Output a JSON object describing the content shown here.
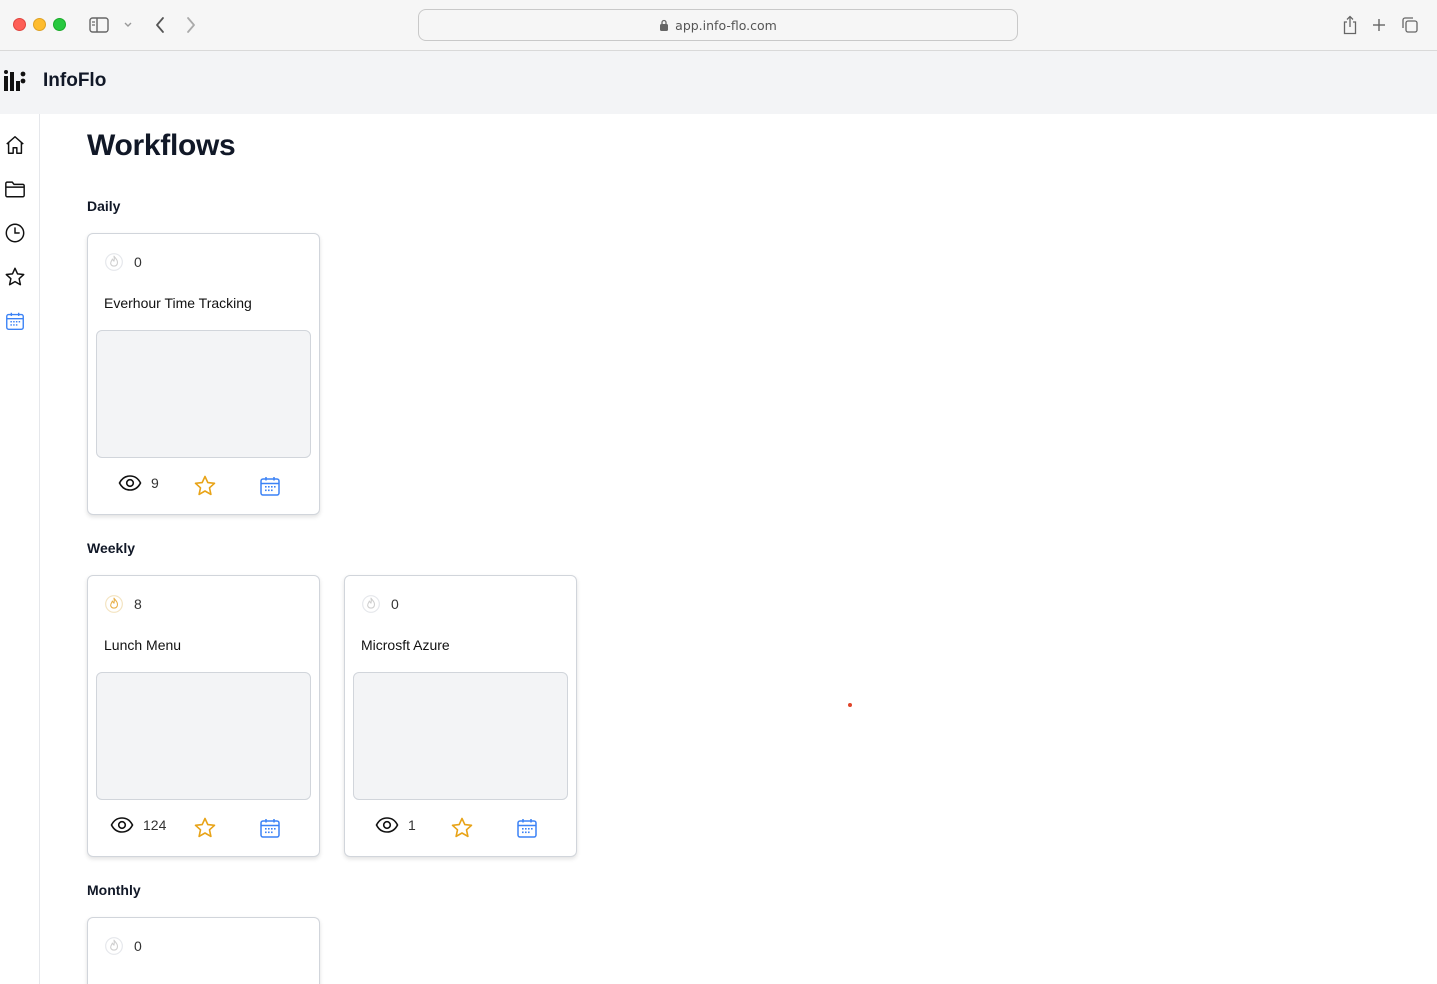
{
  "browser": {
    "url": "app.info-flo.com"
  },
  "app": {
    "name": "InfoFlo"
  },
  "sidebar": {
    "items": [
      {
        "icon": "home-icon"
      },
      {
        "icon": "folder-icon"
      },
      {
        "icon": "clock-icon"
      },
      {
        "icon": "star-icon"
      },
      {
        "icon": "calendar-icon",
        "active": true
      }
    ]
  },
  "page": {
    "title": "Workflows"
  },
  "sections": [
    {
      "title": "Daily",
      "cards": [
        {
          "count": "0",
          "name": "Everhour Time Tracking",
          "views": "9"
        }
      ]
    },
    {
      "title": "Weekly",
      "cards": [
        {
          "count": "8",
          "name": "Lunch Menu",
          "views": "124"
        },
        {
          "count": "0",
          "name": "Microsft Azure",
          "views": "1"
        }
      ]
    },
    {
      "title": "Monthly",
      "cards": [
        {
          "count": "0",
          "name": "",
          "views": ""
        }
      ]
    }
  ],
  "colors": {
    "accent_blue": "#3b82f6",
    "star_gold": "#e8a317",
    "header_bg": "#f3f4f6"
  }
}
